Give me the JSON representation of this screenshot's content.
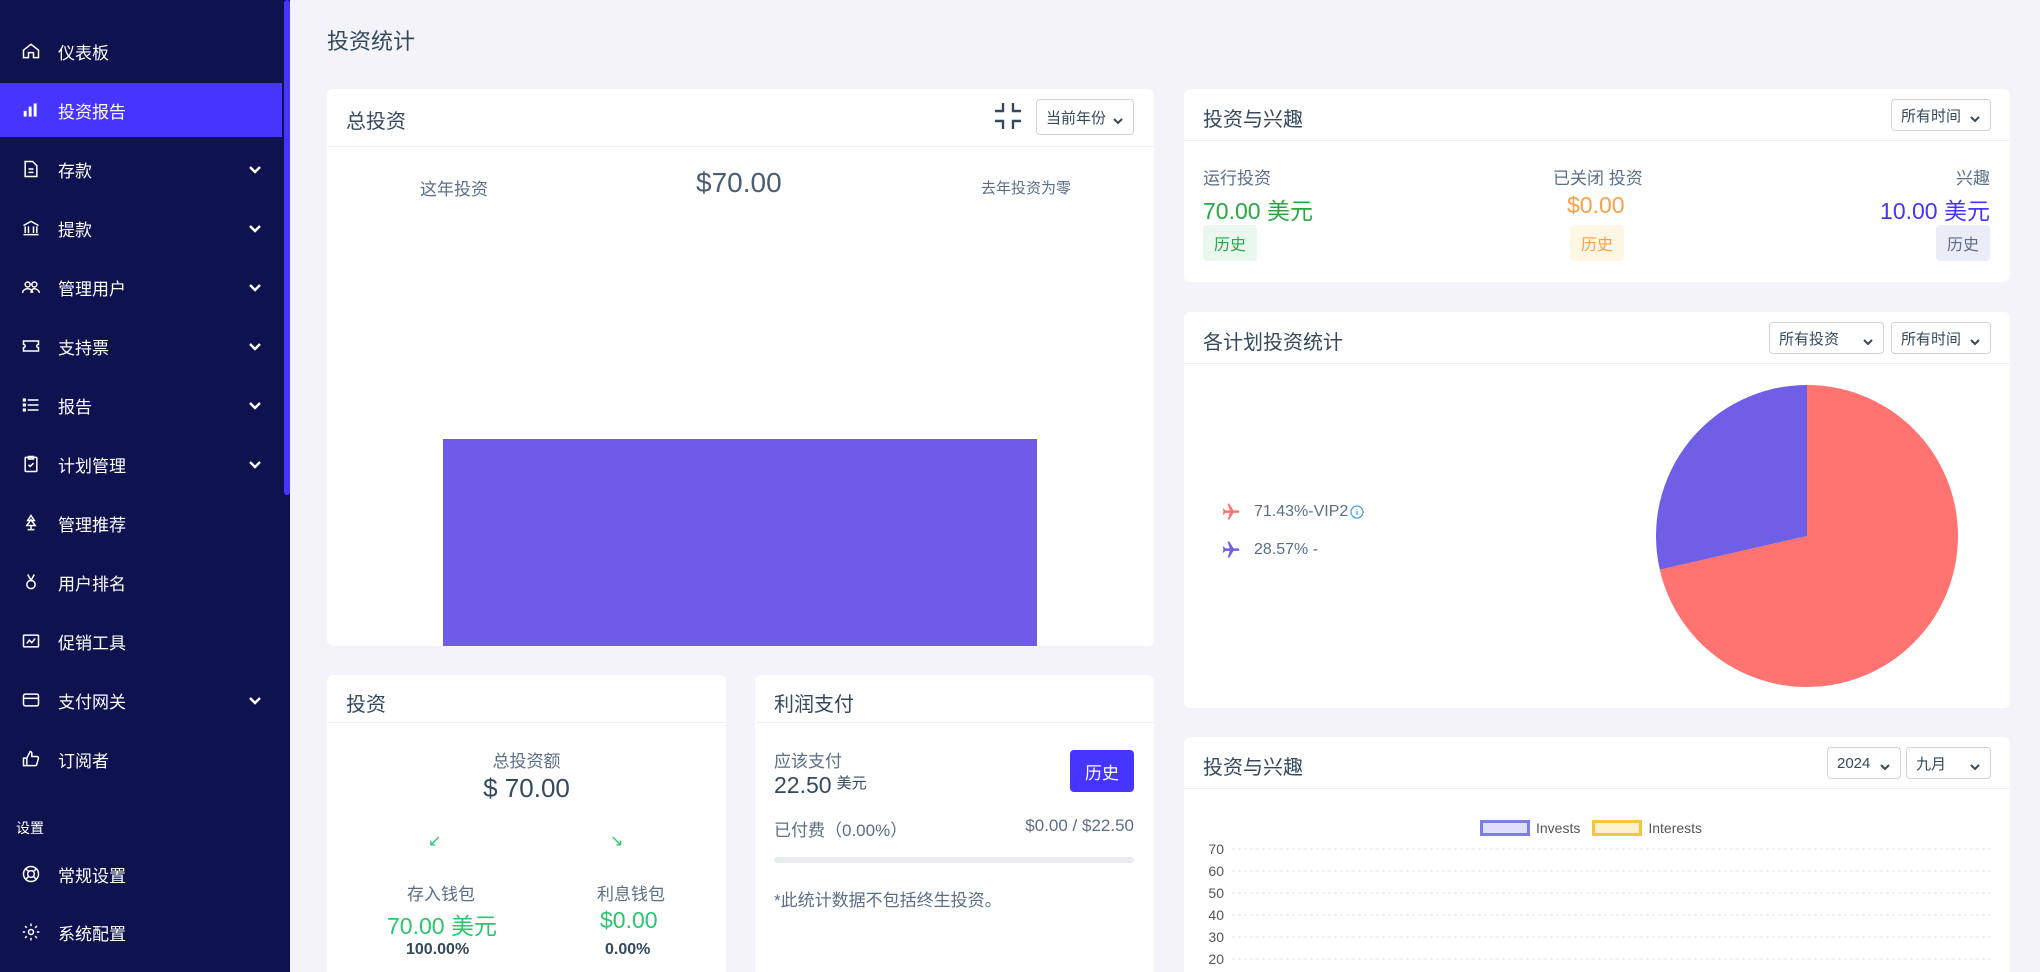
{
  "sidebar": {
    "items": [
      {
        "label": "仪表板",
        "icon": "home-icon",
        "chevron": false,
        "active": false
      },
      {
        "label": "投资报告",
        "icon": "bar-chart-icon",
        "chevron": false,
        "active": true
      },
      {
        "label": "存款",
        "icon": "deposit-icon",
        "chevron": true,
        "active": false
      },
      {
        "label": "提款",
        "icon": "bank-icon",
        "chevron": true,
        "active": false
      },
      {
        "label": "管理用户",
        "icon": "users-icon",
        "chevron": true,
        "active": false
      },
      {
        "label": "支持票",
        "icon": "ticket-icon",
        "chevron": true,
        "active": false
      },
      {
        "label": "报告",
        "icon": "list-icon",
        "chevron": true,
        "active": false
      },
      {
        "label": "计划管理",
        "icon": "clipboard-icon",
        "chevron": true,
        "active": false
      },
      {
        "label": "管理推荐",
        "icon": "tree-icon",
        "chevron": false,
        "active": false
      },
      {
        "label": "用户排名",
        "icon": "medal-icon",
        "chevron": false,
        "active": false
      },
      {
        "label": "促销工具",
        "icon": "promo-icon",
        "chevron": false,
        "active": false
      },
      {
        "label": "支付网关",
        "icon": "credit-card-icon",
        "chevron": true,
        "active": false
      },
      {
        "label": "订阅者",
        "icon": "thumbs-up-icon",
        "chevron": false,
        "active": false
      }
    ],
    "section_label": "设置",
    "settings_items": [
      {
        "label": "常规设置",
        "icon": "lifebuoy-icon"
      },
      {
        "label": "系统配置",
        "icon": "gear-icon"
      }
    ]
  },
  "page": {
    "title": "投资统计"
  },
  "total_invest": {
    "title": "总投资",
    "select": "当前年份",
    "this_year_label": "这年投资",
    "amount": "$70.00",
    "last_year_label": "去年投资为零",
    "bar_color": "#6e5be8"
  },
  "invest_interest": {
    "title": "投资与兴趣",
    "select": "所有时间",
    "running_label": "运行投资",
    "running_value": "70.00 美元",
    "closed_label": "已关闭 投资",
    "closed_value": "$0.00",
    "interest_label": "兴趣",
    "interest_value": "10.00 美元",
    "history": "历史"
  },
  "plan_stats": {
    "title": "各计划投资统计",
    "select_invest": "所有投资",
    "select_time": "所有时间",
    "legend": [
      {
        "label": "71.43%-VIP2",
        "color": "#ff7370"
      },
      {
        "label": "28.57% -",
        "color": "#6f5ee6"
      }
    ],
    "slices": [
      71.43,
      28.57
    ]
  },
  "invest_card": {
    "title": "投资",
    "total_label": "总投资额",
    "total_value": "$ 70.00",
    "deposit_wallet_label": "存入钱包",
    "deposit_wallet_value": "70.00 美元",
    "deposit_wallet_pct": "100.00%",
    "interest_wallet_label": "利息钱包",
    "interest_wallet_value": "$0.00",
    "interest_wallet_pct": "0.00%"
  },
  "profit_pay": {
    "title": "利润支付",
    "should_pay_label": "应该支付",
    "should_pay_value": "22.50",
    "should_pay_unit": "美元",
    "history_btn": "历史",
    "paid_label": "已付费（0.00%）",
    "paid_value": "$0.00 / $22.50",
    "progress": 0,
    "note": "*此统计数据不包括终生投资。"
  },
  "invest_interest_chart": {
    "title": "投资与兴趣",
    "select_year": "2024",
    "select_month": "九月",
    "chart_data": {
      "type": "line",
      "series": [
        {
          "name": "Invests",
          "color": "#7b7fe3"
        },
        {
          "name": "Interests",
          "color": "#f5c542"
        }
      ],
      "y_ticks": [
        "70",
        "60",
        "50",
        "40",
        "30",
        "20"
      ]
    }
  }
}
